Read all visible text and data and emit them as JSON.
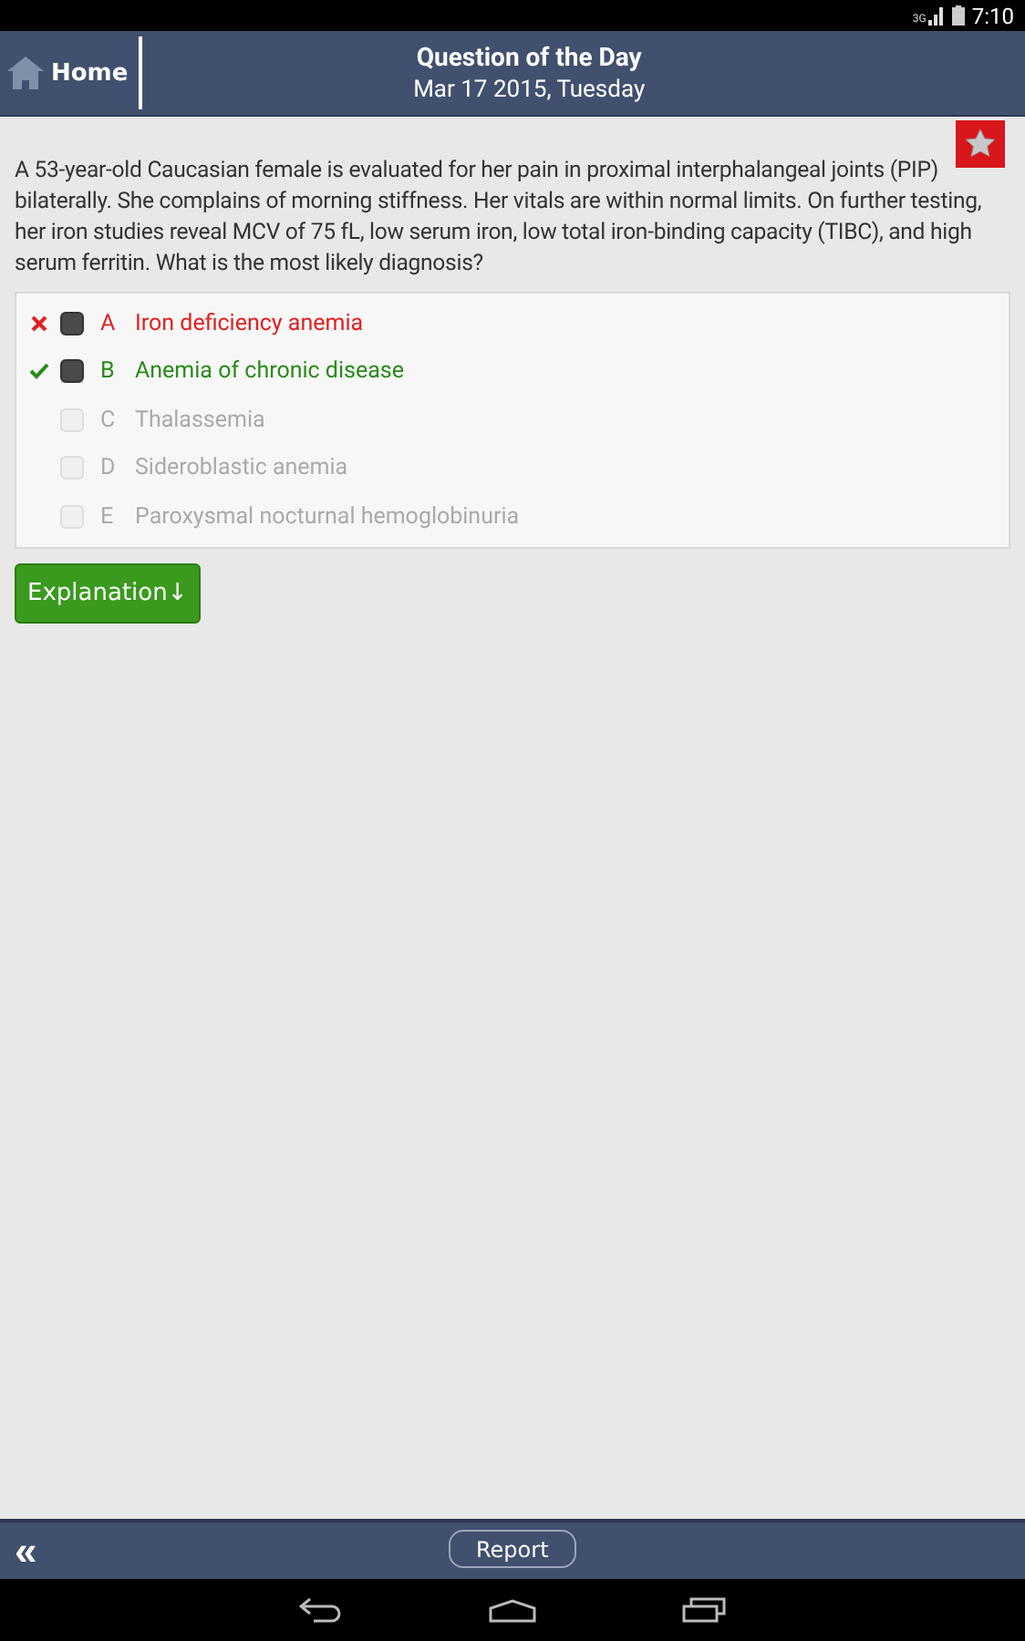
{
  "status_bar": {
    "network": "3G",
    "time": "7:10"
  },
  "header": {
    "home_label": "Home",
    "title": "Question of the Day",
    "date": "Mar 17 2015, Tuesday"
  },
  "question": {
    "bookmarked": true,
    "text": "A 53-year-old Caucasian female is evaluated for her pain in proximal interphalangeal joints (PIP) bilaterally. She complains of morning stiffness. Her vitals are within normal limits. On further testing, her iron studies reveal MCV of 75 fL, low serum iron, low total iron-binding capacity (TIBC), and high serum ferritin. What is the most likely diagnosis?"
  },
  "options": [
    {
      "letter": "A",
      "text": "Iron deficiency anemia",
      "kind": "wrong",
      "checked": true
    },
    {
      "letter": "B",
      "text": "Anemia of chronic disease",
      "kind": "correct",
      "checked": true
    },
    {
      "letter": "C",
      "text": "Thalassemia",
      "kind": "plain",
      "checked": false
    },
    {
      "letter": "D",
      "text": "Sideroblastic anemia",
      "kind": "plain",
      "checked": false
    },
    {
      "letter": "E",
      "text": "Paroxysmal nocturnal hemoglobinuria",
      "kind": "plain",
      "checked": false
    }
  ],
  "explanation_button": {
    "label": "Explanation",
    "arrow": "↓"
  },
  "bottom_bar": {
    "back": "«",
    "report": "Report"
  }
}
